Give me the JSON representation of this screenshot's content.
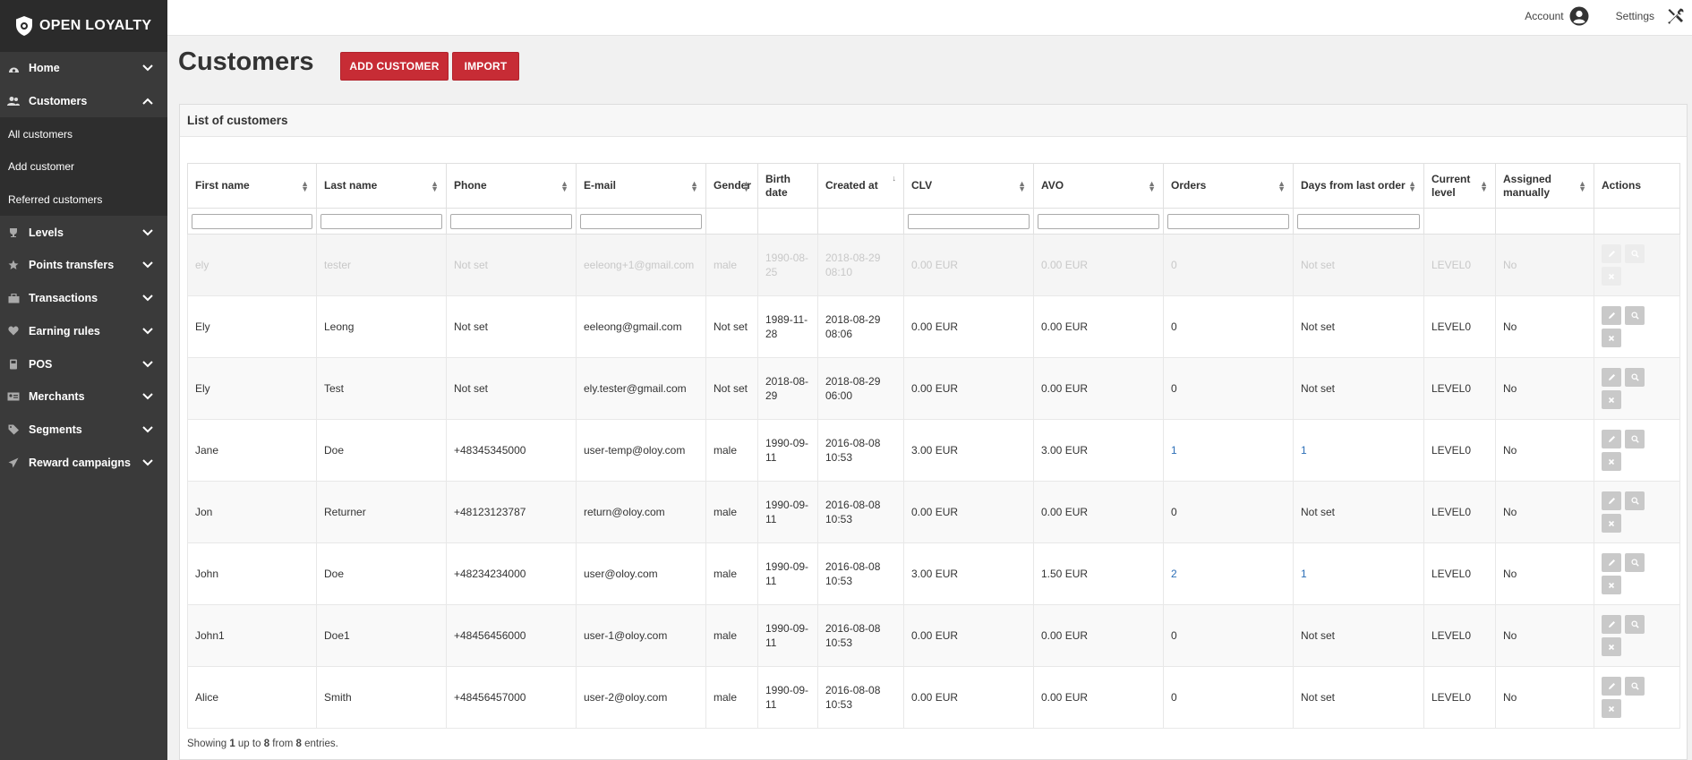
{
  "app": {
    "logo_text": "OPEN LOYALTY"
  },
  "sidebar": {
    "items": [
      {
        "label": "Home",
        "icon": "dashboard-icon",
        "chevron": "down"
      },
      {
        "label": "Customers",
        "icon": "users-icon",
        "chevron": "up"
      },
      {
        "label": "Levels",
        "icon": "trophy-icon",
        "chevron": "down"
      },
      {
        "label": "Points transfers",
        "icon": "star-icon",
        "chevron": "down"
      },
      {
        "label": "Transactions",
        "icon": "briefcase-icon",
        "chevron": "down"
      },
      {
        "label": "Earning rules",
        "icon": "heart-icon",
        "chevron": "down"
      },
      {
        "label": "POS",
        "icon": "pos-icon",
        "chevron": "down"
      },
      {
        "label": "Merchants",
        "icon": "id-card-icon",
        "chevron": "down"
      },
      {
        "label": "Segments",
        "icon": "tags-icon",
        "chevron": "down"
      },
      {
        "label": "Reward campaigns",
        "icon": "paper-plane-icon",
        "chevron": "down"
      }
    ],
    "customers_sub": [
      "All customers",
      "Add customer",
      "Referred customers"
    ]
  },
  "topbar": {
    "account": "Account",
    "settings": "Settings"
  },
  "page": {
    "title": "Customers",
    "add_button": "ADD CUSTOMER",
    "import_button": "IMPORT",
    "panel_title": "List of customers"
  },
  "table": {
    "columns": [
      "First name",
      "Last name",
      "Phone",
      "E-mail",
      "Gender",
      "Birth date",
      "Created at",
      "CLV",
      "AVO",
      "Orders",
      "Days from last order",
      "Current level",
      "Assigned manually",
      "Actions"
    ],
    "rows": [
      [
        "ely",
        "tester",
        "Not set",
        "eeleong+1@gmail.com",
        "male",
        "1990-08-25",
        "2018-08-29 08:10",
        "0.00  EUR",
        "0.00  EUR",
        "0",
        "Not set",
        "LEVEL0",
        "No"
      ],
      [
        "Ely",
        "Leong",
        "Not set",
        "eeleong@gmail.com",
        "Not set",
        "1989-11-28",
        "2018-08-29 08:06",
        "0.00  EUR",
        "0.00  EUR",
        "0",
        "Not set",
        "LEVEL0",
        "No"
      ],
      [
        "Ely",
        "Test",
        "Not set",
        "ely.tester@gmail.com",
        "Not set",
        "2018-08-29",
        "2018-08-29 06:00",
        "0.00  EUR",
        "0.00  EUR",
        "0",
        "Not set",
        "LEVEL0",
        "No"
      ],
      [
        "Jane",
        "Doe",
        "+48345345000",
        "user-temp@oloy.com",
        "male",
        "1990-09-11",
        "2016-08-08 10:53",
        "3.00  EUR",
        "3.00  EUR",
        "1",
        "1",
        "LEVEL0",
        "No"
      ],
      [
        "Jon",
        "Returner",
        "+48123123787",
        "return@oloy.com",
        "male",
        "1990-09-11",
        "2016-08-08 10:53",
        "0.00  EUR",
        "0.00  EUR",
        "0",
        "Not set",
        "LEVEL0",
        "No"
      ],
      [
        "John",
        "Doe",
        "+48234234000",
        "user@oloy.com",
        "male",
        "1990-09-11",
        "2016-08-08 10:53",
        "3.00  EUR",
        "1.50  EUR",
        "2",
        "1",
        "LEVEL0",
        "No"
      ],
      [
        "John1",
        "Doe1",
        "+48456456000",
        "user-1@oloy.com",
        "male",
        "1990-09-11",
        "2016-08-08 10:53",
        "0.00  EUR",
        "0.00  EUR",
        "0",
        "Not set",
        "LEVEL0",
        "No"
      ],
      [
        "Alice",
        "Smith",
        "+48456457000",
        "user-2@oloy.com",
        "male",
        "1990-09-11",
        "2016-08-08 10:53",
        "0.00  EUR",
        "0.00  EUR",
        "0",
        "Not set",
        "LEVEL0",
        "No"
      ]
    ]
  },
  "footer": {
    "prefix": "Showing ",
    "from": "1",
    "mid1": " up to ",
    "to": "8",
    "mid2": " from ",
    "total": "8",
    "suffix": " entries."
  },
  "colors": {
    "brand_red": "#c72c35",
    "sidebar_bg": "#3a3a3a",
    "link_blue": "#2d6fb7"
  }
}
